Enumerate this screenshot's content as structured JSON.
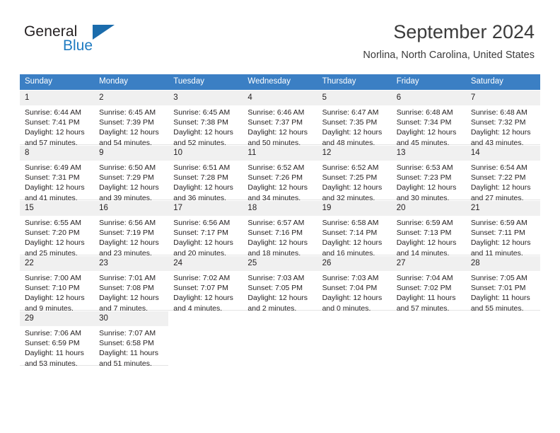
{
  "brand": {
    "name_part1": "General",
    "name_part2": "Blue",
    "flag_icon": "triangle-flag-icon"
  },
  "header": {
    "title": "September 2024",
    "subtitle": "Norlina, North Carolina, United States"
  },
  "colors": {
    "header_blue": "#3b7fc4",
    "brand_blue": "#1f7bc1",
    "flag_blue": "#1b6cac",
    "daynum_bg": "#f0f0f0",
    "text": "#231f20",
    "rule": "#d8d8d8"
  },
  "calendar": {
    "weekday_headers": [
      "Sunday",
      "Monday",
      "Tuesday",
      "Wednesday",
      "Thursday",
      "Friday",
      "Saturday"
    ],
    "weeks": [
      [
        {
          "day": "1",
          "sunrise": "Sunrise: 6:44 AM",
          "sunset": "Sunset: 7:41 PM",
          "daylight": "Daylight: 12 hours and 57 minutes."
        },
        {
          "day": "2",
          "sunrise": "Sunrise: 6:45 AM",
          "sunset": "Sunset: 7:39 PM",
          "daylight": "Daylight: 12 hours and 54 minutes."
        },
        {
          "day": "3",
          "sunrise": "Sunrise: 6:45 AM",
          "sunset": "Sunset: 7:38 PM",
          "daylight": "Daylight: 12 hours and 52 minutes."
        },
        {
          "day": "4",
          "sunrise": "Sunrise: 6:46 AM",
          "sunset": "Sunset: 7:37 PM",
          "daylight": "Daylight: 12 hours and 50 minutes."
        },
        {
          "day": "5",
          "sunrise": "Sunrise: 6:47 AM",
          "sunset": "Sunset: 7:35 PM",
          "daylight": "Daylight: 12 hours and 48 minutes."
        },
        {
          "day": "6",
          "sunrise": "Sunrise: 6:48 AM",
          "sunset": "Sunset: 7:34 PM",
          "daylight": "Daylight: 12 hours and 45 minutes."
        },
        {
          "day": "7",
          "sunrise": "Sunrise: 6:48 AM",
          "sunset": "Sunset: 7:32 PM",
          "daylight": "Daylight: 12 hours and 43 minutes."
        }
      ],
      [
        {
          "day": "8",
          "sunrise": "Sunrise: 6:49 AM",
          "sunset": "Sunset: 7:31 PM",
          "daylight": "Daylight: 12 hours and 41 minutes."
        },
        {
          "day": "9",
          "sunrise": "Sunrise: 6:50 AM",
          "sunset": "Sunset: 7:29 PM",
          "daylight": "Daylight: 12 hours and 39 minutes."
        },
        {
          "day": "10",
          "sunrise": "Sunrise: 6:51 AM",
          "sunset": "Sunset: 7:28 PM",
          "daylight": "Daylight: 12 hours and 36 minutes."
        },
        {
          "day": "11",
          "sunrise": "Sunrise: 6:52 AM",
          "sunset": "Sunset: 7:26 PM",
          "daylight": "Daylight: 12 hours and 34 minutes."
        },
        {
          "day": "12",
          "sunrise": "Sunrise: 6:52 AM",
          "sunset": "Sunset: 7:25 PM",
          "daylight": "Daylight: 12 hours and 32 minutes."
        },
        {
          "day": "13",
          "sunrise": "Sunrise: 6:53 AM",
          "sunset": "Sunset: 7:23 PM",
          "daylight": "Daylight: 12 hours and 30 minutes."
        },
        {
          "day": "14",
          "sunrise": "Sunrise: 6:54 AM",
          "sunset": "Sunset: 7:22 PM",
          "daylight": "Daylight: 12 hours and 27 minutes."
        }
      ],
      [
        {
          "day": "15",
          "sunrise": "Sunrise: 6:55 AM",
          "sunset": "Sunset: 7:20 PM",
          "daylight": "Daylight: 12 hours and 25 minutes."
        },
        {
          "day": "16",
          "sunrise": "Sunrise: 6:56 AM",
          "sunset": "Sunset: 7:19 PM",
          "daylight": "Daylight: 12 hours and 23 minutes."
        },
        {
          "day": "17",
          "sunrise": "Sunrise: 6:56 AM",
          "sunset": "Sunset: 7:17 PM",
          "daylight": "Daylight: 12 hours and 20 minutes."
        },
        {
          "day": "18",
          "sunrise": "Sunrise: 6:57 AM",
          "sunset": "Sunset: 7:16 PM",
          "daylight": "Daylight: 12 hours and 18 minutes."
        },
        {
          "day": "19",
          "sunrise": "Sunrise: 6:58 AM",
          "sunset": "Sunset: 7:14 PM",
          "daylight": "Daylight: 12 hours and 16 minutes."
        },
        {
          "day": "20",
          "sunrise": "Sunrise: 6:59 AM",
          "sunset": "Sunset: 7:13 PM",
          "daylight": "Daylight: 12 hours and 14 minutes."
        },
        {
          "day": "21",
          "sunrise": "Sunrise: 6:59 AM",
          "sunset": "Sunset: 7:11 PM",
          "daylight": "Daylight: 12 hours and 11 minutes."
        }
      ],
      [
        {
          "day": "22",
          "sunrise": "Sunrise: 7:00 AM",
          "sunset": "Sunset: 7:10 PM",
          "daylight": "Daylight: 12 hours and 9 minutes."
        },
        {
          "day": "23",
          "sunrise": "Sunrise: 7:01 AM",
          "sunset": "Sunset: 7:08 PM",
          "daylight": "Daylight: 12 hours and 7 minutes."
        },
        {
          "day": "24",
          "sunrise": "Sunrise: 7:02 AM",
          "sunset": "Sunset: 7:07 PM",
          "daylight": "Daylight: 12 hours and 4 minutes."
        },
        {
          "day": "25",
          "sunrise": "Sunrise: 7:03 AM",
          "sunset": "Sunset: 7:05 PM",
          "daylight": "Daylight: 12 hours and 2 minutes."
        },
        {
          "day": "26",
          "sunrise": "Sunrise: 7:03 AM",
          "sunset": "Sunset: 7:04 PM",
          "daylight": "Daylight: 12 hours and 0 minutes."
        },
        {
          "day": "27",
          "sunrise": "Sunrise: 7:04 AM",
          "sunset": "Sunset: 7:02 PM",
          "daylight": "Daylight: 11 hours and 57 minutes."
        },
        {
          "day": "28",
          "sunrise": "Sunrise: 7:05 AM",
          "sunset": "Sunset: 7:01 PM",
          "daylight": "Daylight: 11 hours and 55 minutes."
        }
      ],
      [
        {
          "day": "29",
          "sunrise": "Sunrise: 7:06 AM",
          "sunset": "Sunset: 6:59 PM",
          "daylight": "Daylight: 11 hours and 53 minutes."
        },
        {
          "day": "30",
          "sunrise": "Sunrise: 7:07 AM",
          "sunset": "Sunset: 6:58 PM",
          "daylight": "Daylight: 11 hours and 51 minutes."
        },
        {
          "day": "",
          "sunrise": "",
          "sunset": "",
          "daylight": ""
        },
        {
          "day": "",
          "sunrise": "",
          "sunset": "",
          "daylight": ""
        },
        {
          "day": "",
          "sunrise": "",
          "sunset": "",
          "daylight": ""
        },
        {
          "day": "",
          "sunrise": "",
          "sunset": "",
          "daylight": ""
        },
        {
          "day": "",
          "sunrise": "",
          "sunset": "",
          "daylight": ""
        }
      ]
    ]
  }
}
